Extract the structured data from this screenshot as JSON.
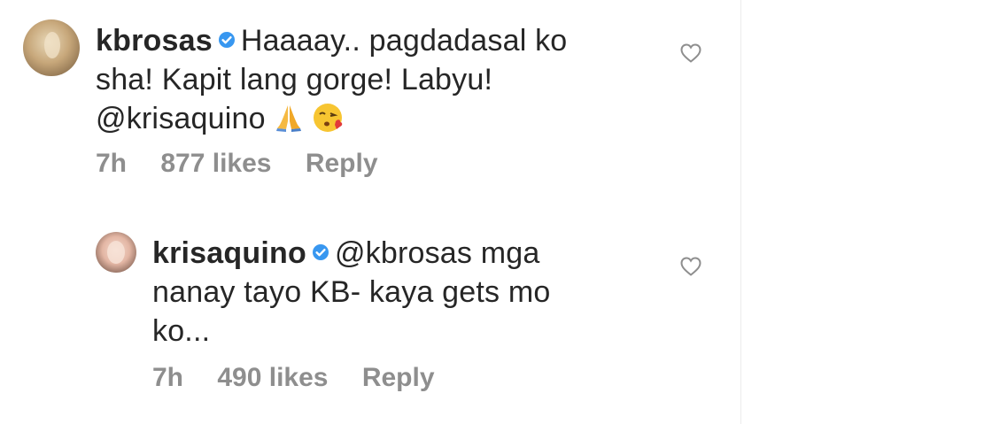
{
  "comments": [
    {
      "username": "kbrosas",
      "text_line1": "Haaaay.. pagdadasal ko",
      "text_line2": "sha! Kapit lang gorge! Labyu!",
      "text_line3": "@krisaquino",
      "emojis": [
        "praying-hands-emoji",
        "face-blowing-kiss-emoji"
      ],
      "time": "7h",
      "likes": "877 likes",
      "reply_label": "Reply",
      "verified": true
    },
    {
      "username": "krisaquino",
      "mention": "@kbrosas",
      "text_line1": "mga",
      "text_line2": "nanay tayo KB- kaya gets mo",
      "text_line3": "ko...",
      "time": "7h",
      "likes": "490 likes",
      "reply_label": "Reply",
      "verified": true
    }
  ],
  "colors": {
    "text": "#262626",
    "meta": "#8e8e8e",
    "verified_badge": "#3897f0"
  },
  "icons": {
    "like": "heart-outline-icon",
    "verified": "verified-badge-icon"
  }
}
